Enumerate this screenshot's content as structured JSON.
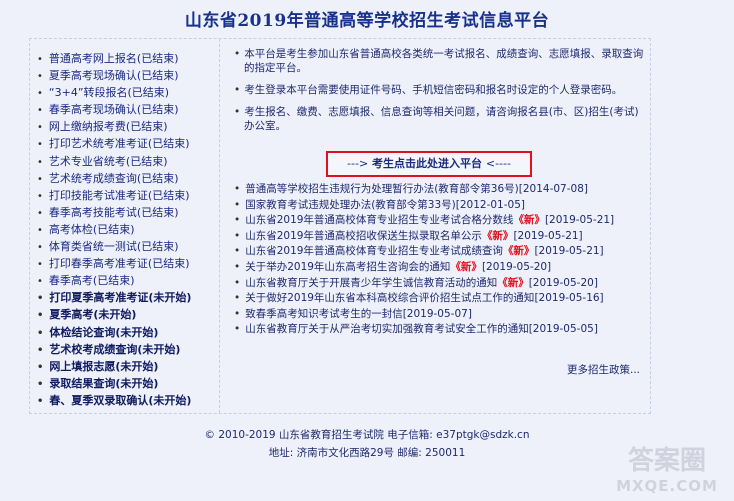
{
  "title": "山东省2019年普通高等学校招生考试信息平台",
  "left_menu": [
    {
      "label": "普通高考网上报名(已结束)",
      "bold": false
    },
    {
      "label": "夏季高考现场确认(已结束)",
      "bold": false
    },
    {
      "label": "“3+4”转段报名(已结束)",
      "bold": false
    },
    {
      "label": "春季高考现场确认(已结束)",
      "bold": false
    },
    {
      "label": "网上缴纳报考费(已结束)",
      "bold": false
    },
    {
      "label": "打印艺术统考准考证(已结束)",
      "bold": false
    },
    {
      "label": "艺术专业省统考(已结束)",
      "bold": false
    },
    {
      "label": "艺术统考成绩查询(已结束)",
      "bold": false
    },
    {
      "label": "打印技能考试准考证(已结束)",
      "bold": false
    },
    {
      "label": "春季高考技能考试(已结束)",
      "bold": false
    },
    {
      "label": "高考体检(已结束)",
      "bold": false
    },
    {
      "label": "体育类省统一测试(已结束)",
      "bold": false
    },
    {
      "label": "打印春季高考准考证(已结束)",
      "bold": false
    },
    {
      "label": "春季高考(已结束)",
      "bold": false
    },
    {
      "label": "打印夏季高考准考证(未开始)",
      "bold": true
    },
    {
      "label": "夏季高考(未开始)",
      "bold": true
    },
    {
      "label": "体检结论查询(未开始)",
      "bold": true
    },
    {
      "label": "艺术校考成绩查询(未开始)",
      "bold": true
    },
    {
      "label": "网上填报志愿(未开始)",
      "bold": true
    },
    {
      "label": "录取结果查询(未开始)",
      "bold": true
    },
    {
      "label": "春、夏季双录取确认(未开始)",
      "bold": true
    }
  ],
  "intro": [
    "本平台是考生参加山东省普通高校各类统一考试报名、成绩查询、志愿填报、录取查询的指定平台。",
    "考生登录本平台需要使用证件号码、手机短信密码和报名时设定的个人登录密码。",
    "考生报名、缴费、志愿填报、信息查询等相关问题，请咨询报名县(市、区)招生(考试)办公室。"
  ],
  "enter_button": {
    "arrow_left": "--->",
    "label": "考生点击此处进入平台",
    "arrow_right": "<----"
  },
  "news": [
    {
      "text": "普通高等学校招生违规行为处理暂行办法(教育部令第36号)",
      "new": "",
      "date": "[2014-07-08]"
    },
    {
      "text": "国家教育考试违规处理办法(教育部令第33号)",
      "new": "",
      "date": "[2012-01-05]"
    },
    {
      "text": "山东省2019年普通高校体育专业招生专业考试合格分数线",
      "new": "《新》",
      "date": "[2019-05-21]"
    },
    {
      "text": "山东省2019年普通高校招收保送生拟录取名单公示",
      "new": "《新》",
      "date": "[2019-05-21]"
    },
    {
      "text": "山东省2019年普通高校体育专业招生专业考试成绩查询",
      "new": "《新》",
      "date": "[2019-05-21]"
    },
    {
      "text": "关于举办2019年山东高考招生咨询会的通知",
      "new": "《新》",
      "date": "[2019-05-20]"
    },
    {
      "text": "山东省教育厅关于开展青少年学生诚信教育活动的通知",
      "new": "《新》",
      "date": "[2019-05-20]"
    },
    {
      "text": "关于做好2019年山东省本科高校综合评价招生试点工作的通知",
      "new": "",
      "date": "[2019-05-16]"
    },
    {
      "text": "致春季高考知识考试考生的一封信",
      "new": "",
      "date": "[2019-05-07]"
    },
    {
      "text": "山东省教育厅关于从严治考切实加强教育考试安全工作的通知",
      "new": "",
      "date": "[2019-05-05]"
    }
  ],
  "more": "更多招生政策...",
  "footer": {
    "line1": "© 2010-2019  山东省教育招生考试院  电子信箱: e37ptgk@sdzk.cn",
    "line2": "地址: 济南市文化西路29号  邮编: 250011"
  },
  "watermark": {
    "line1": "答案圈",
    "line2": "MXQE.COM"
  }
}
